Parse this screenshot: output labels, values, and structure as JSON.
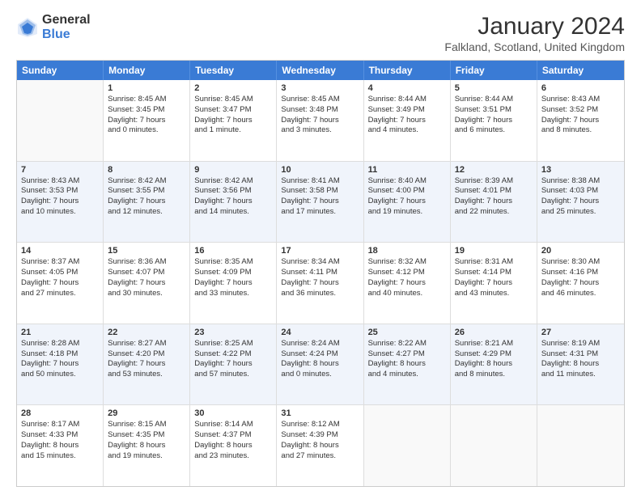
{
  "header": {
    "logo_general": "General",
    "logo_blue": "Blue",
    "month_title": "January 2024",
    "location": "Falkland, Scotland, United Kingdom"
  },
  "days_of_week": [
    "Sunday",
    "Monday",
    "Tuesday",
    "Wednesday",
    "Thursday",
    "Friday",
    "Saturday"
  ],
  "rows": [
    {
      "alt": false,
      "cells": [
        {
          "day": "",
          "text": ""
        },
        {
          "day": "1",
          "text": "Sunrise: 8:45 AM\nSunset: 3:45 PM\nDaylight: 7 hours\nand 0 minutes."
        },
        {
          "day": "2",
          "text": "Sunrise: 8:45 AM\nSunset: 3:47 PM\nDaylight: 7 hours\nand 1 minute."
        },
        {
          "day": "3",
          "text": "Sunrise: 8:45 AM\nSunset: 3:48 PM\nDaylight: 7 hours\nand 3 minutes."
        },
        {
          "day": "4",
          "text": "Sunrise: 8:44 AM\nSunset: 3:49 PM\nDaylight: 7 hours\nand 4 minutes."
        },
        {
          "day": "5",
          "text": "Sunrise: 8:44 AM\nSunset: 3:51 PM\nDaylight: 7 hours\nand 6 minutes."
        },
        {
          "day": "6",
          "text": "Sunrise: 8:43 AM\nSunset: 3:52 PM\nDaylight: 7 hours\nand 8 minutes."
        }
      ]
    },
    {
      "alt": true,
      "cells": [
        {
          "day": "7",
          "text": "Sunrise: 8:43 AM\nSunset: 3:53 PM\nDaylight: 7 hours\nand 10 minutes."
        },
        {
          "day": "8",
          "text": "Sunrise: 8:42 AM\nSunset: 3:55 PM\nDaylight: 7 hours\nand 12 minutes."
        },
        {
          "day": "9",
          "text": "Sunrise: 8:42 AM\nSunset: 3:56 PM\nDaylight: 7 hours\nand 14 minutes."
        },
        {
          "day": "10",
          "text": "Sunrise: 8:41 AM\nSunset: 3:58 PM\nDaylight: 7 hours\nand 17 minutes."
        },
        {
          "day": "11",
          "text": "Sunrise: 8:40 AM\nSunset: 4:00 PM\nDaylight: 7 hours\nand 19 minutes."
        },
        {
          "day": "12",
          "text": "Sunrise: 8:39 AM\nSunset: 4:01 PM\nDaylight: 7 hours\nand 22 minutes."
        },
        {
          "day": "13",
          "text": "Sunrise: 8:38 AM\nSunset: 4:03 PM\nDaylight: 7 hours\nand 25 minutes."
        }
      ]
    },
    {
      "alt": false,
      "cells": [
        {
          "day": "14",
          "text": "Sunrise: 8:37 AM\nSunset: 4:05 PM\nDaylight: 7 hours\nand 27 minutes."
        },
        {
          "day": "15",
          "text": "Sunrise: 8:36 AM\nSunset: 4:07 PM\nDaylight: 7 hours\nand 30 minutes."
        },
        {
          "day": "16",
          "text": "Sunrise: 8:35 AM\nSunset: 4:09 PM\nDaylight: 7 hours\nand 33 minutes."
        },
        {
          "day": "17",
          "text": "Sunrise: 8:34 AM\nSunset: 4:11 PM\nDaylight: 7 hours\nand 36 minutes."
        },
        {
          "day": "18",
          "text": "Sunrise: 8:32 AM\nSunset: 4:12 PM\nDaylight: 7 hours\nand 40 minutes."
        },
        {
          "day": "19",
          "text": "Sunrise: 8:31 AM\nSunset: 4:14 PM\nDaylight: 7 hours\nand 43 minutes."
        },
        {
          "day": "20",
          "text": "Sunrise: 8:30 AM\nSunset: 4:16 PM\nDaylight: 7 hours\nand 46 minutes."
        }
      ]
    },
    {
      "alt": true,
      "cells": [
        {
          "day": "21",
          "text": "Sunrise: 8:28 AM\nSunset: 4:18 PM\nDaylight: 7 hours\nand 50 minutes."
        },
        {
          "day": "22",
          "text": "Sunrise: 8:27 AM\nSunset: 4:20 PM\nDaylight: 7 hours\nand 53 minutes."
        },
        {
          "day": "23",
          "text": "Sunrise: 8:25 AM\nSunset: 4:22 PM\nDaylight: 7 hours\nand 57 minutes."
        },
        {
          "day": "24",
          "text": "Sunrise: 8:24 AM\nSunset: 4:24 PM\nDaylight: 8 hours\nand 0 minutes."
        },
        {
          "day": "25",
          "text": "Sunrise: 8:22 AM\nSunset: 4:27 PM\nDaylight: 8 hours\nand 4 minutes."
        },
        {
          "day": "26",
          "text": "Sunrise: 8:21 AM\nSunset: 4:29 PM\nDaylight: 8 hours\nand 8 minutes."
        },
        {
          "day": "27",
          "text": "Sunrise: 8:19 AM\nSunset: 4:31 PM\nDaylight: 8 hours\nand 11 minutes."
        }
      ]
    },
    {
      "alt": false,
      "cells": [
        {
          "day": "28",
          "text": "Sunrise: 8:17 AM\nSunset: 4:33 PM\nDaylight: 8 hours\nand 15 minutes."
        },
        {
          "day": "29",
          "text": "Sunrise: 8:15 AM\nSunset: 4:35 PM\nDaylight: 8 hours\nand 19 minutes."
        },
        {
          "day": "30",
          "text": "Sunrise: 8:14 AM\nSunset: 4:37 PM\nDaylight: 8 hours\nand 23 minutes."
        },
        {
          "day": "31",
          "text": "Sunrise: 8:12 AM\nSunset: 4:39 PM\nDaylight: 8 hours\nand 27 minutes."
        },
        {
          "day": "",
          "text": ""
        },
        {
          "day": "",
          "text": ""
        },
        {
          "day": "",
          "text": ""
        }
      ]
    }
  ]
}
